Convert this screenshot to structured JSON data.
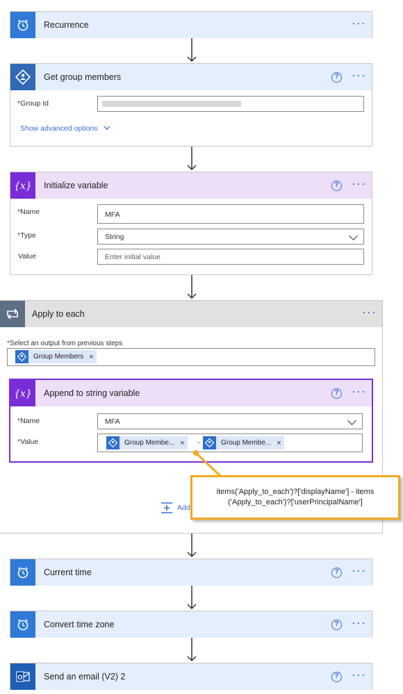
{
  "steps": {
    "recurrence": {
      "title": "Recurrence",
      "icon": "alarm-clock-icon"
    },
    "get_group_members": {
      "title": "Get group members",
      "icon": "azure-ad-icon",
      "group_id_label": "Group Id",
      "show_advanced": "Show advanced options"
    },
    "initialize_variable": {
      "title": "Initialize variable",
      "icon": "variable-icon",
      "name_label": "Name",
      "name_value": "MFA",
      "type_label": "Type",
      "type_value": "String",
      "value_label": "Value",
      "value_placeholder": "Enter initial value"
    },
    "apply_to_each": {
      "title": "Apply to each",
      "icon": "loop-icon",
      "select_label": "Select an output from previous steps",
      "token_label": "Group Members",
      "add_action_partial": "Add"
    },
    "append_to_string": {
      "title": "Append to string variable",
      "icon": "variable-icon",
      "name_label": "Name",
      "name_value": "MFA",
      "value_label": "Value",
      "token1": "Group Membe...",
      "separator": "-",
      "token2": "Group Membe..."
    },
    "current_time": {
      "title": "Current time",
      "icon": "alarm-clock-icon"
    },
    "convert_time_zone": {
      "title": "Convert time zone",
      "icon": "alarm-clock-icon"
    },
    "send_email": {
      "title": "Send an email (V2) 2",
      "icon": "outlook-icon"
    }
  },
  "callout": {
    "line1": "items('Apply_to_each')?['displayName'] - items",
    "line2": "('Apply_to_each')?['userPrincipalName']"
  },
  "common": {
    "help_glyph": "?",
    "more_glyph": "···",
    "remove_glyph": "×",
    "required_mark": "*"
  },
  "colors": {
    "header_blue": "#e5eefc",
    "header_purple": "#ecdff7",
    "header_gray": "#e1e1e1",
    "accent_blue": "#3a6bd6",
    "variable_purple": "#7a2dd6",
    "callout_border": "#f2a91e"
  }
}
